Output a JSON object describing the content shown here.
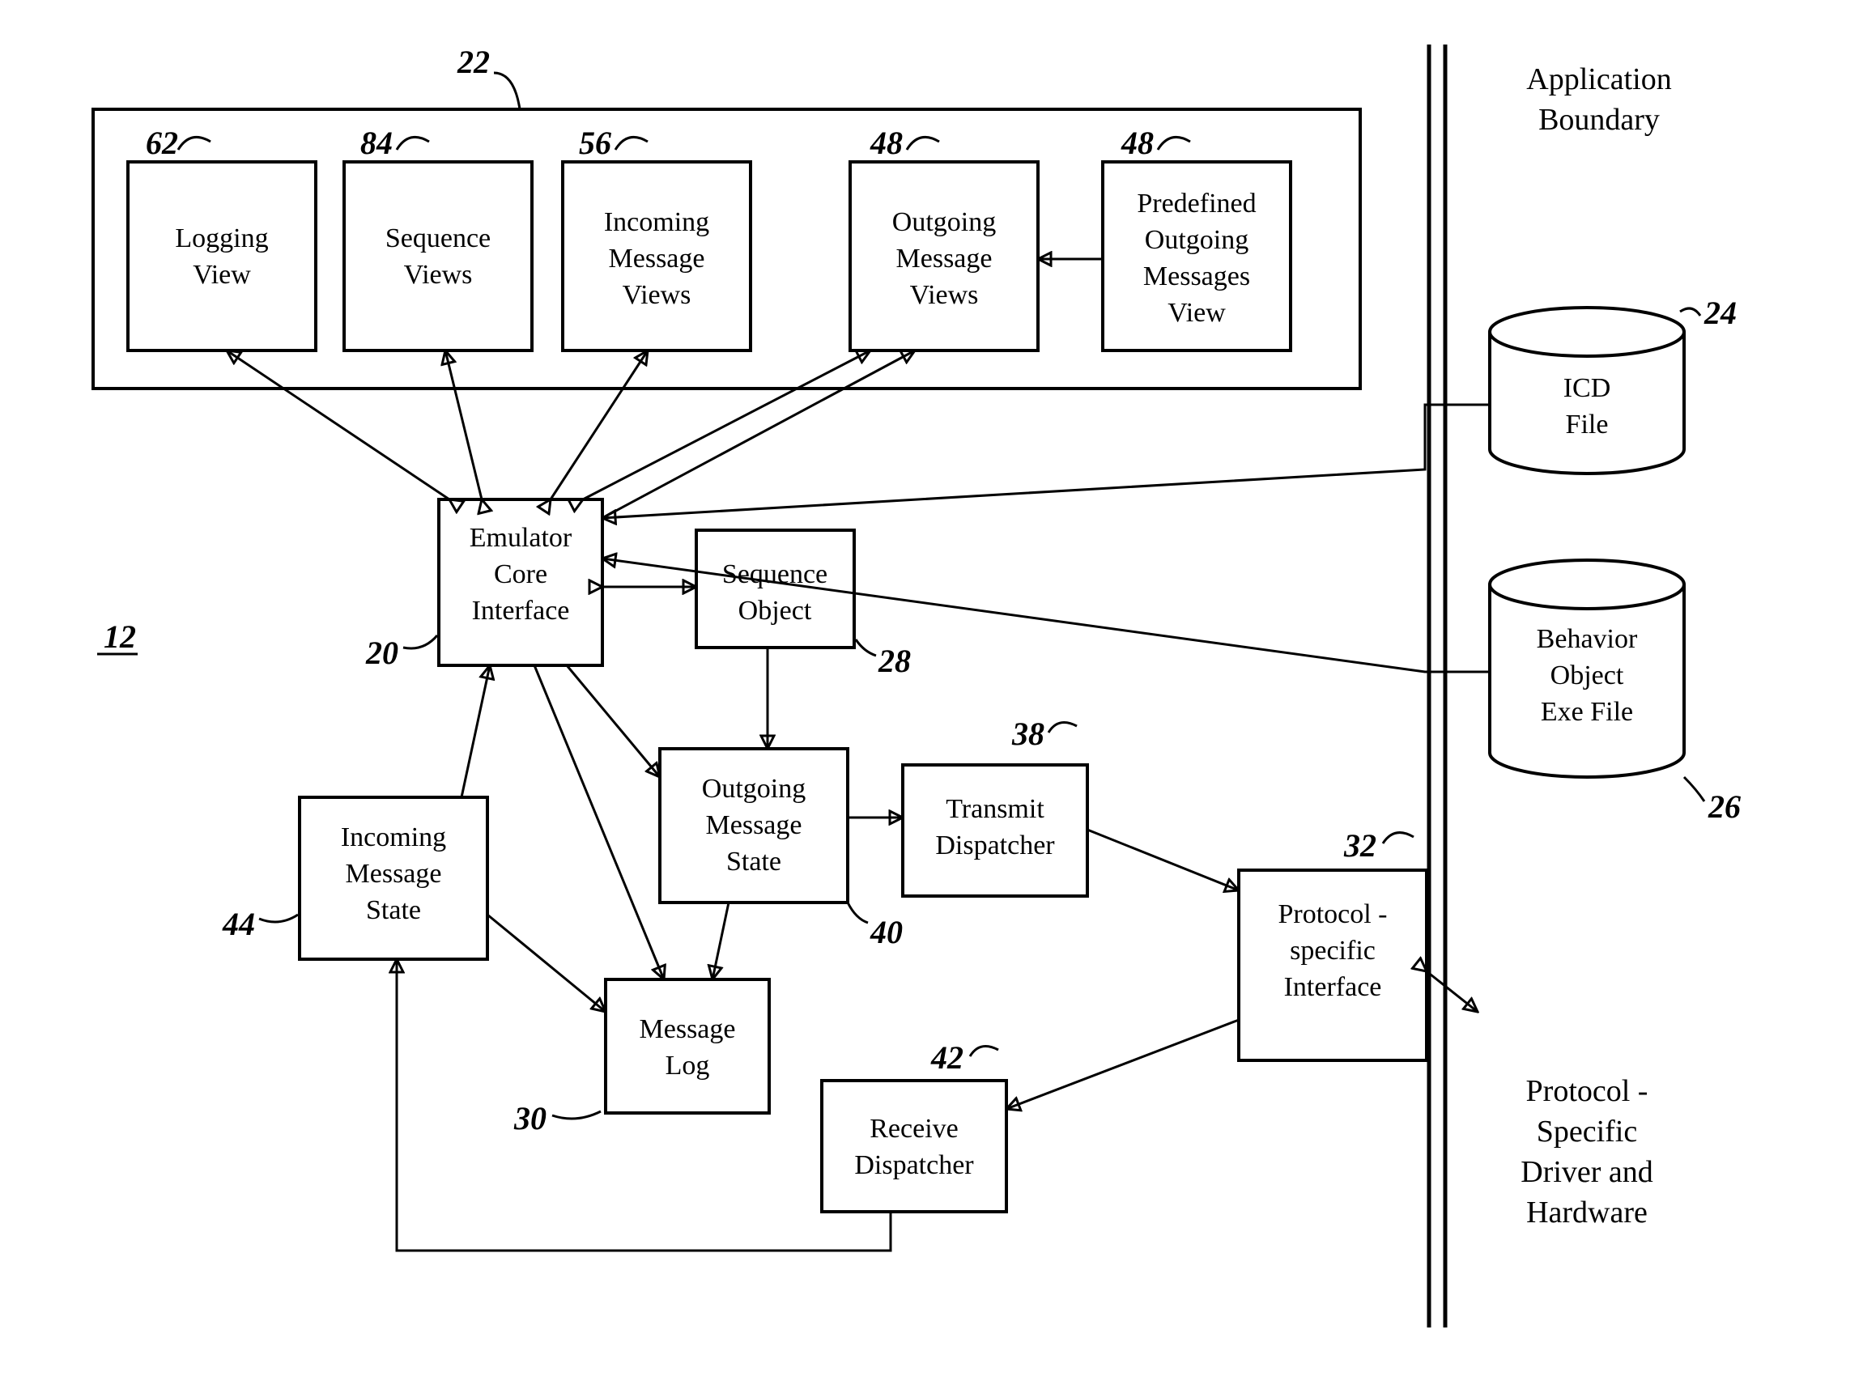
{
  "refs": {
    "overall": "12",
    "topContainer": "22",
    "loggingView": "62",
    "sequenceViews": "84",
    "incomingViews": "56",
    "outgoingViews": "48",
    "predefinedViews": "48",
    "emulatorCore": "20",
    "sequenceObject": "28",
    "outgoingState": "40",
    "messageLog": "30",
    "incomingState": "44",
    "transmitDispatcher": "38",
    "receiveDispatcher": "42",
    "protocolInterface": "32",
    "icdFile": "24",
    "behaviorFile": "26"
  },
  "boxes": {
    "loggingView": [
      "Logging",
      "View"
    ],
    "sequenceViews": [
      "Sequence",
      "Views"
    ],
    "incomingViews": [
      "Incoming",
      "Message",
      "Views"
    ],
    "outgoingViews": [
      "Outgoing",
      "Message",
      "Views"
    ],
    "predefinedViews": [
      "Predefined",
      "Outgoing",
      "Messages",
      "View"
    ],
    "emulatorCore": [
      "Emulator",
      "Core",
      "Interface"
    ],
    "sequenceObject": [
      "Sequence",
      "Object"
    ],
    "outgoingState": [
      "Outgoing",
      "Message",
      "State"
    ],
    "messageLog": [
      "Message",
      "Log"
    ],
    "incomingState": [
      "Incoming",
      "Message",
      "State"
    ],
    "transmitDispatcher": [
      "Transmit",
      "Dispatcher"
    ],
    "receiveDispatcher": [
      "Receive",
      "Dispatcher"
    ],
    "protocolInterface": [
      "Protocol -",
      "specific",
      "Interface"
    ]
  },
  "labels": {
    "applicationBoundary": [
      "Application",
      "Boundary"
    ],
    "icdFile": [
      "ICD",
      "File"
    ],
    "behaviorFile": [
      "Behavior",
      "Object",
      "Exe File"
    ],
    "protocolDriver": [
      "Protocol -",
      "Specific",
      "Driver and",
      "Hardware"
    ]
  }
}
